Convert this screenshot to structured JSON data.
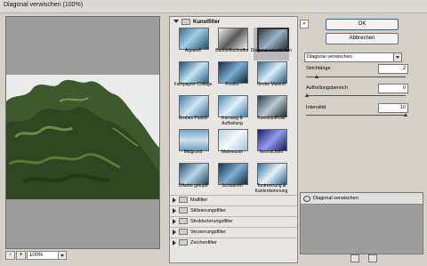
{
  "window": {
    "title": "Diagonal verwischen (100%)"
  },
  "preview": {
    "zoom": "100%",
    "minus": "-",
    "plus": "+"
  },
  "gallery": {
    "category": "Kunstfilter",
    "thumbnails": [
      {
        "label": "Aquarell"
      },
      {
        "label": "Buntstiftschraffur"
      },
      {
        "label": "Diagonal verwischen",
        "selected": true
      },
      {
        "label": "Farbpapier-Collage"
      },
      {
        "label": "Fresko"
      },
      {
        "label": "Grobe Malerei"
      },
      {
        "label": "Grobes Pastell"
      },
      {
        "label": "Körnung & Aufhellung"
      },
      {
        "label": "Kunststofffolie"
      },
      {
        "label": "Malgrund"
      },
      {
        "label": "Malmesser"
      },
      {
        "label": "Neonschein"
      },
      {
        "label": "Ölfarbe getupft"
      },
      {
        "label": "Schwamm"
      },
      {
        "label": "Tontrennung & Kantenbetonung"
      }
    ],
    "subcategories": [
      "Malfilter",
      "Stilisierungsfilter",
      "Strukturierungsfilter",
      "Verzerrungsfilter",
      "Zeichenfilter"
    ]
  },
  "dialog": {
    "collapse_symbol": "«",
    "ok": "OK",
    "cancel": "Abbrechen",
    "filter_select": "Diagonal verwischen",
    "params": [
      {
        "label": "Strichlänge",
        "value": "2",
        "level": 0.1
      },
      {
        "label": "Aufhellungsbereich",
        "value": "0",
        "level": 0.0
      },
      {
        "label": "Intensität",
        "value": "10",
        "level": 1.0
      }
    ],
    "layer": {
      "name": "Diagonal verwischen"
    }
  },
  "colors": {
    "selected_border": "#2b5fa8",
    "background": "#d4d0c8"
  }
}
